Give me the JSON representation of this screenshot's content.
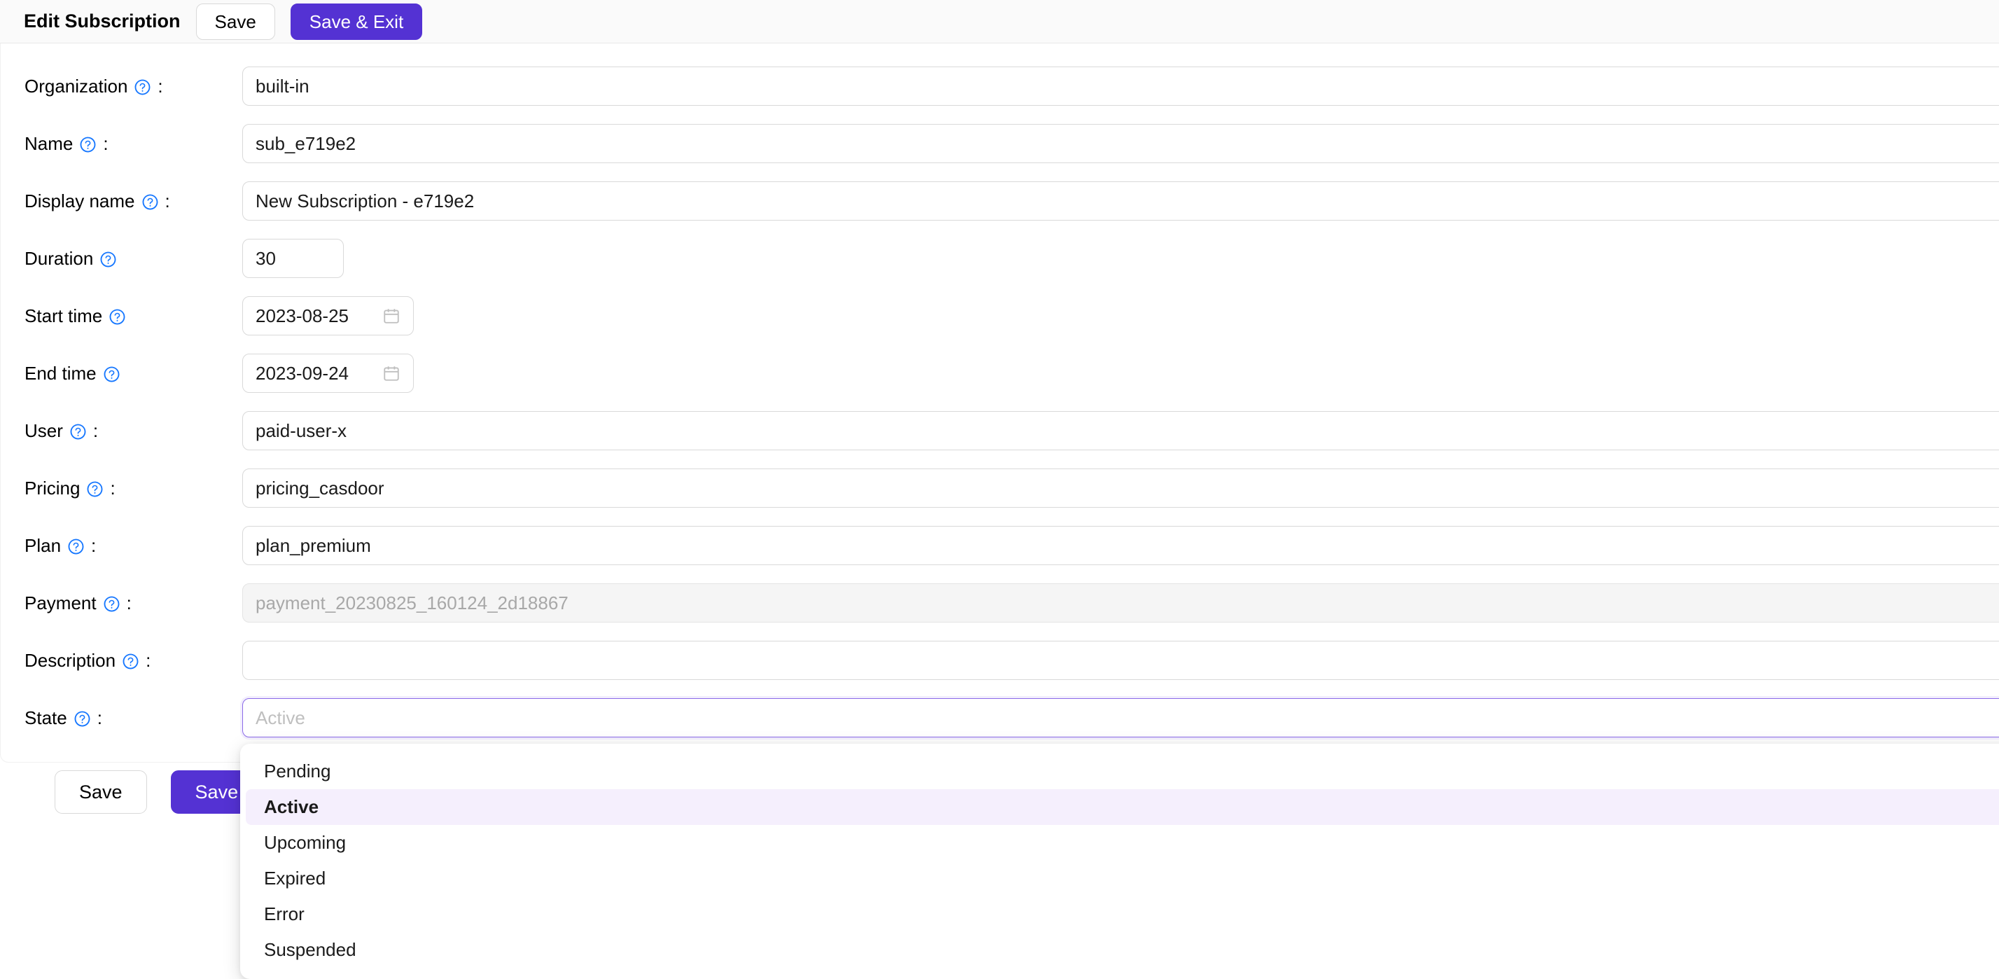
{
  "header": {
    "title": "Edit Subscription",
    "save_label": "Save",
    "save_exit_label": "Save & Exit"
  },
  "colors": {
    "accent": "#5432d3",
    "dropdown_highlight": "#f5effd",
    "help_icon": "#1677ff",
    "header_bg": "#fafafa",
    "disabled_bg": "#f5f5f5"
  },
  "form": {
    "fields": [
      {
        "label": "Organization",
        "colon": ":",
        "help_icon": "question-circle-icon",
        "value": "built-in",
        "type": "text",
        "width": "full"
      },
      {
        "label": "Name",
        "colon": ":",
        "help_icon": "question-circle-icon",
        "value": "sub_e719e2",
        "type": "text",
        "width": "full"
      },
      {
        "label": "Display name",
        "colon": ":",
        "help_icon": "question-circle-icon",
        "value": "New Subscription - e719e2",
        "type": "text",
        "width": "full"
      },
      {
        "label": "Duration",
        "colon": "",
        "help_icon": "question-circle-icon",
        "value": "30",
        "type": "number",
        "width": "narrow"
      },
      {
        "label": "Start time",
        "colon": "",
        "help_icon": "question-circle-icon",
        "value": "2023-08-25",
        "type": "date",
        "width": "date"
      },
      {
        "label": "End time",
        "colon": "",
        "help_icon": "question-circle-icon",
        "value": "2023-09-24",
        "type": "date",
        "width": "date"
      },
      {
        "label": "User",
        "colon": ":",
        "help_icon": "question-circle-icon",
        "value": "paid-user-x",
        "type": "text",
        "width": "full"
      },
      {
        "label": "Pricing",
        "colon": ":",
        "help_icon": "question-circle-icon",
        "value": "pricing_casdoor",
        "type": "text",
        "width": "full"
      },
      {
        "label": "Plan",
        "colon": ":",
        "help_icon": "question-circle-icon",
        "value": "plan_premium",
        "type": "text",
        "width": "full"
      },
      {
        "label": "Payment",
        "colon": ":",
        "help_icon": "question-circle-icon",
        "value": "payment_20230825_160124_2d18867",
        "type": "text",
        "width": "full",
        "disabled": true
      },
      {
        "label": "Description",
        "colon": ":",
        "help_icon": "question-circle-icon",
        "value": "",
        "type": "text",
        "width": "full"
      },
      {
        "label": "State",
        "colon": ":",
        "help_icon": "question-circle-icon",
        "value": "",
        "placeholder": "Active",
        "type": "select",
        "width": "full",
        "focused": true
      }
    ]
  },
  "state_dropdown": {
    "open": true,
    "selected": "Active",
    "options": [
      {
        "label": "Pending",
        "selected": false
      },
      {
        "label": "Active",
        "selected": true
      },
      {
        "label": "Upcoming",
        "selected": false
      },
      {
        "label": "Expired",
        "selected": false
      },
      {
        "label": "Error",
        "selected": false
      },
      {
        "label": "Suspended",
        "selected": false
      }
    ]
  },
  "footer": {
    "save_label": "Save",
    "save_exit_label": "Save & Exit"
  }
}
